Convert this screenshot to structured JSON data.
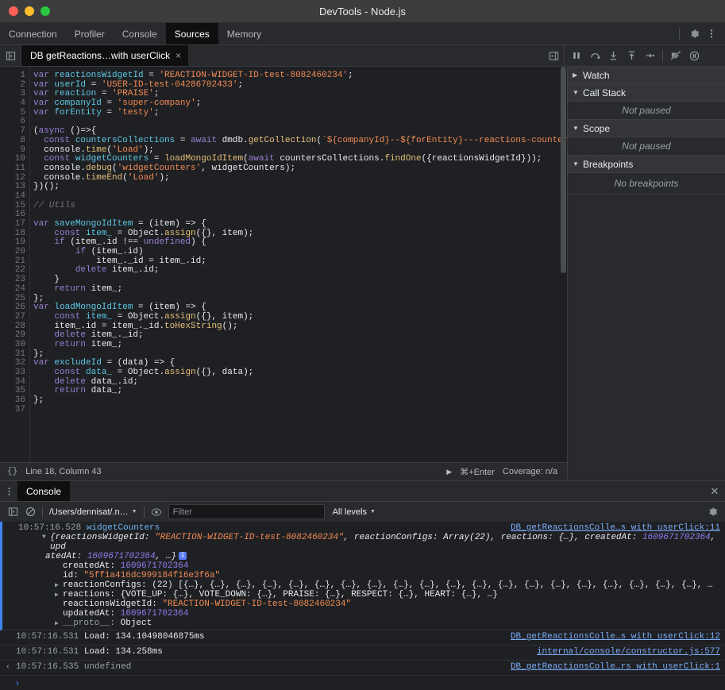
{
  "window": {
    "title": "DevTools - Node.js"
  },
  "main_tabs": [
    {
      "label": "Connection",
      "active": false
    },
    {
      "label": "Profiler",
      "active": false
    },
    {
      "label": "Console",
      "active": false
    },
    {
      "label": "Sources",
      "active": true
    },
    {
      "label": "Memory",
      "active": false
    }
  ],
  "toolbar_icons": {
    "settings": "gear-icon",
    "more": "kebab-menu-icon"
  },
  "editor_tab": {
    "label": "DB getReactions…with userClick",
    "close": "×"
  },
  "debugger_toolbar": {
    "resume": "pause-resume-icon",
    "step_over": "step-over-icon",
    "step_into": "step-into-icon",
    "step_out": "step-out-icon",
    "step": "step-icon",
    "deactivate_breakpoints": "deactivate-breakpoints-icon",
    "pause_on_exceptions": "pause-on-exceptions-icon"
  },
  "editor": {
    "line_numbers": [
      "1",
      "2",
      "3",
      "4",
      "5",
      "6",
      "7",
      "8",
      "9",
      "10",
      "11",
      "12",
      "13",
      "14",
      "15",
      "16",
      "17",
      "18",
      "19",
      "20",
      "21",
      "22",
      "23",
      "24",
      "25",
      "26",
      "27",
      "28",
      "29",
      "30",
      "31",
      "32",
      "33",
      "34",
      "35",
      "36",
      "37"
    ],
    "lines": [
      "var reactionsWidgetId = 'REACTION-WIDGET-ID-test-8082460234';",
      "var userId = 'USER-ID-test-04286702433';",
      "var reaction = 'PRAISE';",
      "var companyId = 'super-company';",
      "var forEntity = 'testy';",
      "",
      "(async ()=>{",
      "  const countersCollections = await dmdb.getCollection(`${companyId}--${forEntity}---reactions-counters`);",
      "  console.time('Load');",
      "  const widgetCounters = loadMongoIdItem(await countersCollections.findOne({reactionsWidgetId}));",
      "  console.debug('widgetCounters', widgetCounters);",
      "  console.timeEnd('Load');",
      "})();",
      "",
      "// Utils",
      "",
      "var saveMongoIdItem = (item) => {",
      "    const item_ = Object.assign({}, item);",
      "    if (item_.id !== undefined) {",
      "        if (item_.id)",
      "            item_._id = item_.id;",
      "        delete item_.id;",
      "    }",
      "    return item_;",
      "};",
      "var loadMongoIdItem = (item) => {",
      "    const item_ = Object.assign({}, item);",
      "    item_.id = item_._id.toHexString();",
      "    delete item_._id;",
      "    return item_;",
      "};",
      "var excludeId = (data) => {",
      "    const data_ = Object.assign({}, data);",
      "    delete data_.id;",
      "    return data_;",
      "};",
      ""
    ]
  },
  "status_bar": {
    "format_icon": "{}",
    "position": "Line 18, Column 43",
    "run_shortcut": "⌘+Enter",
    "coverage": "Coverage: n/a"
  },
  "sidebar": {
    "panes": [
      {
        "name": "Watch",
        "expanded": false,
        "body": ""
      },
      {
        "name": "Call Stack",
        "expanded": true,
        "body": "Not paused"
      },
      {
        "name": "Scope",
        "expanded": true,
        "body": "Not paused"
      },
      {
        "name": "Breakpoints",
        "expanded": true,
        "body": "No breakpoints"
      }
    ]
  },
  "drawer": {
    "menu_icon": "kebab-menu-icon",
    "tab": "Console",
    "close": "✕"
  },
  "console_toolbar": {
    "sidebar_toggle": "console-sidebar-icon",
    "clear": "clear-console-icon",
    "context": "/Users/dennisat/.n…",
    "eye": "live-expression-icon",
    "filter_placeholder": "Filter",
    "filter_value": "",
    "levels": "All levels",
    "settings": "gear-icon"
  },
  "console": {
    "messages": [
      {
        "type": "group",
        "timestamp": "10:57:16.528",
        "label": "widgetCounters",
        "source": "DB_getReactionsColle…s with userClick:11",
        "preview_a": "{reactionsWidgetId: ",
        "preview_str": "\"REACTION-WIDGET-ID-test-8082460234\"",
        "preview_b": ", reactionConfigs: Array(22), reactions: {…}, createdAt: ",
        "preview_num": "1609671702364",
        "preview_c": ", upd",
        "preview_d": "atedAt: ",
        "preview_num2": "1609671702364",
        "preview_e": ", …}",
        "props": [
          {
            "key": "createdAt:",
            "val": "1609671702364",
            "val_type": "num",
            "expandable": false
          },
          {
            "key": "id:",
            "val": "\"5ff1a416dc999184f16e3f6a\"",
            "val_type": "str",
            "expandable": false
          },
          {
            "key": "reactionConfigs:",
            "val": "(22) [{…}, {…}, {…}, {…}, {…}, {…}, {…}, {…}, {…}, {…}, {…}, {…}, {…}, {…}, {…}, {…}, {…}, {…}, {…}, {…}, …",
            "val_type": "plain",
            "expandable": true
          },
          {
            "key": "reactions:",
            "val": "{VOTE_UP: {…}, VOTE_DOWN: {…}, PRAISE: {…}, RESPECT: {…}, HEART: {…}, …}",
            "val_type": "plain",
            "expandable": true
          },
          {
            "key": "reactionsWidgetId:",
            "val": "\"REACTION-WIDGET-ID-test-8082460234\"",
            "val_type": "str",
            "expandable": false
          },
          {
            "key": "updatedAt:",
            "val": "1609671702364",
            "val_type": "num",
            "expandable": false
          },
          {
            "key": "__proto__:",
            "val": "Object",
            "val_type": "plain",
            "expandable": true,
            "dim": true
          }
        ]
      },
      {
        "type": "log",
        "timestamp": "10:57:16.531",
        "text": "Load: 134.10498046875ms",
        "source": "DB_getReactionsColle…s with userClick:12"
      },
      {
        "type": "log",
        "timestamp": "10:57:16.531",
        "text": "Load: 134.258ms",
        "source": "internal/console/constructor.js:577"
      },
      {
        "type": "result",
        "gutter": "‹",
        "timestamp": "10:57:16.535",
        "text": "undefined",
        "source": "DB_getReactionsColle…rs with userClick:1"
      }
    ],
    "prompt": "›"
  },
  "colors": {
    "accent": "#4285f4",
    "link": "#7cacf8",
    "string": "#f28b54",
    "number": "#8f7ff0",
    "keyword": "#9a7fd6",
    "function": "#e5c07b",
    "identifier": "#5ec8e5",
    "comment": "#747577",
    "bg": "#1f2023",
    "panel": "#282a2d",
    "titlebar": "#3c3c3c"
  }
}
